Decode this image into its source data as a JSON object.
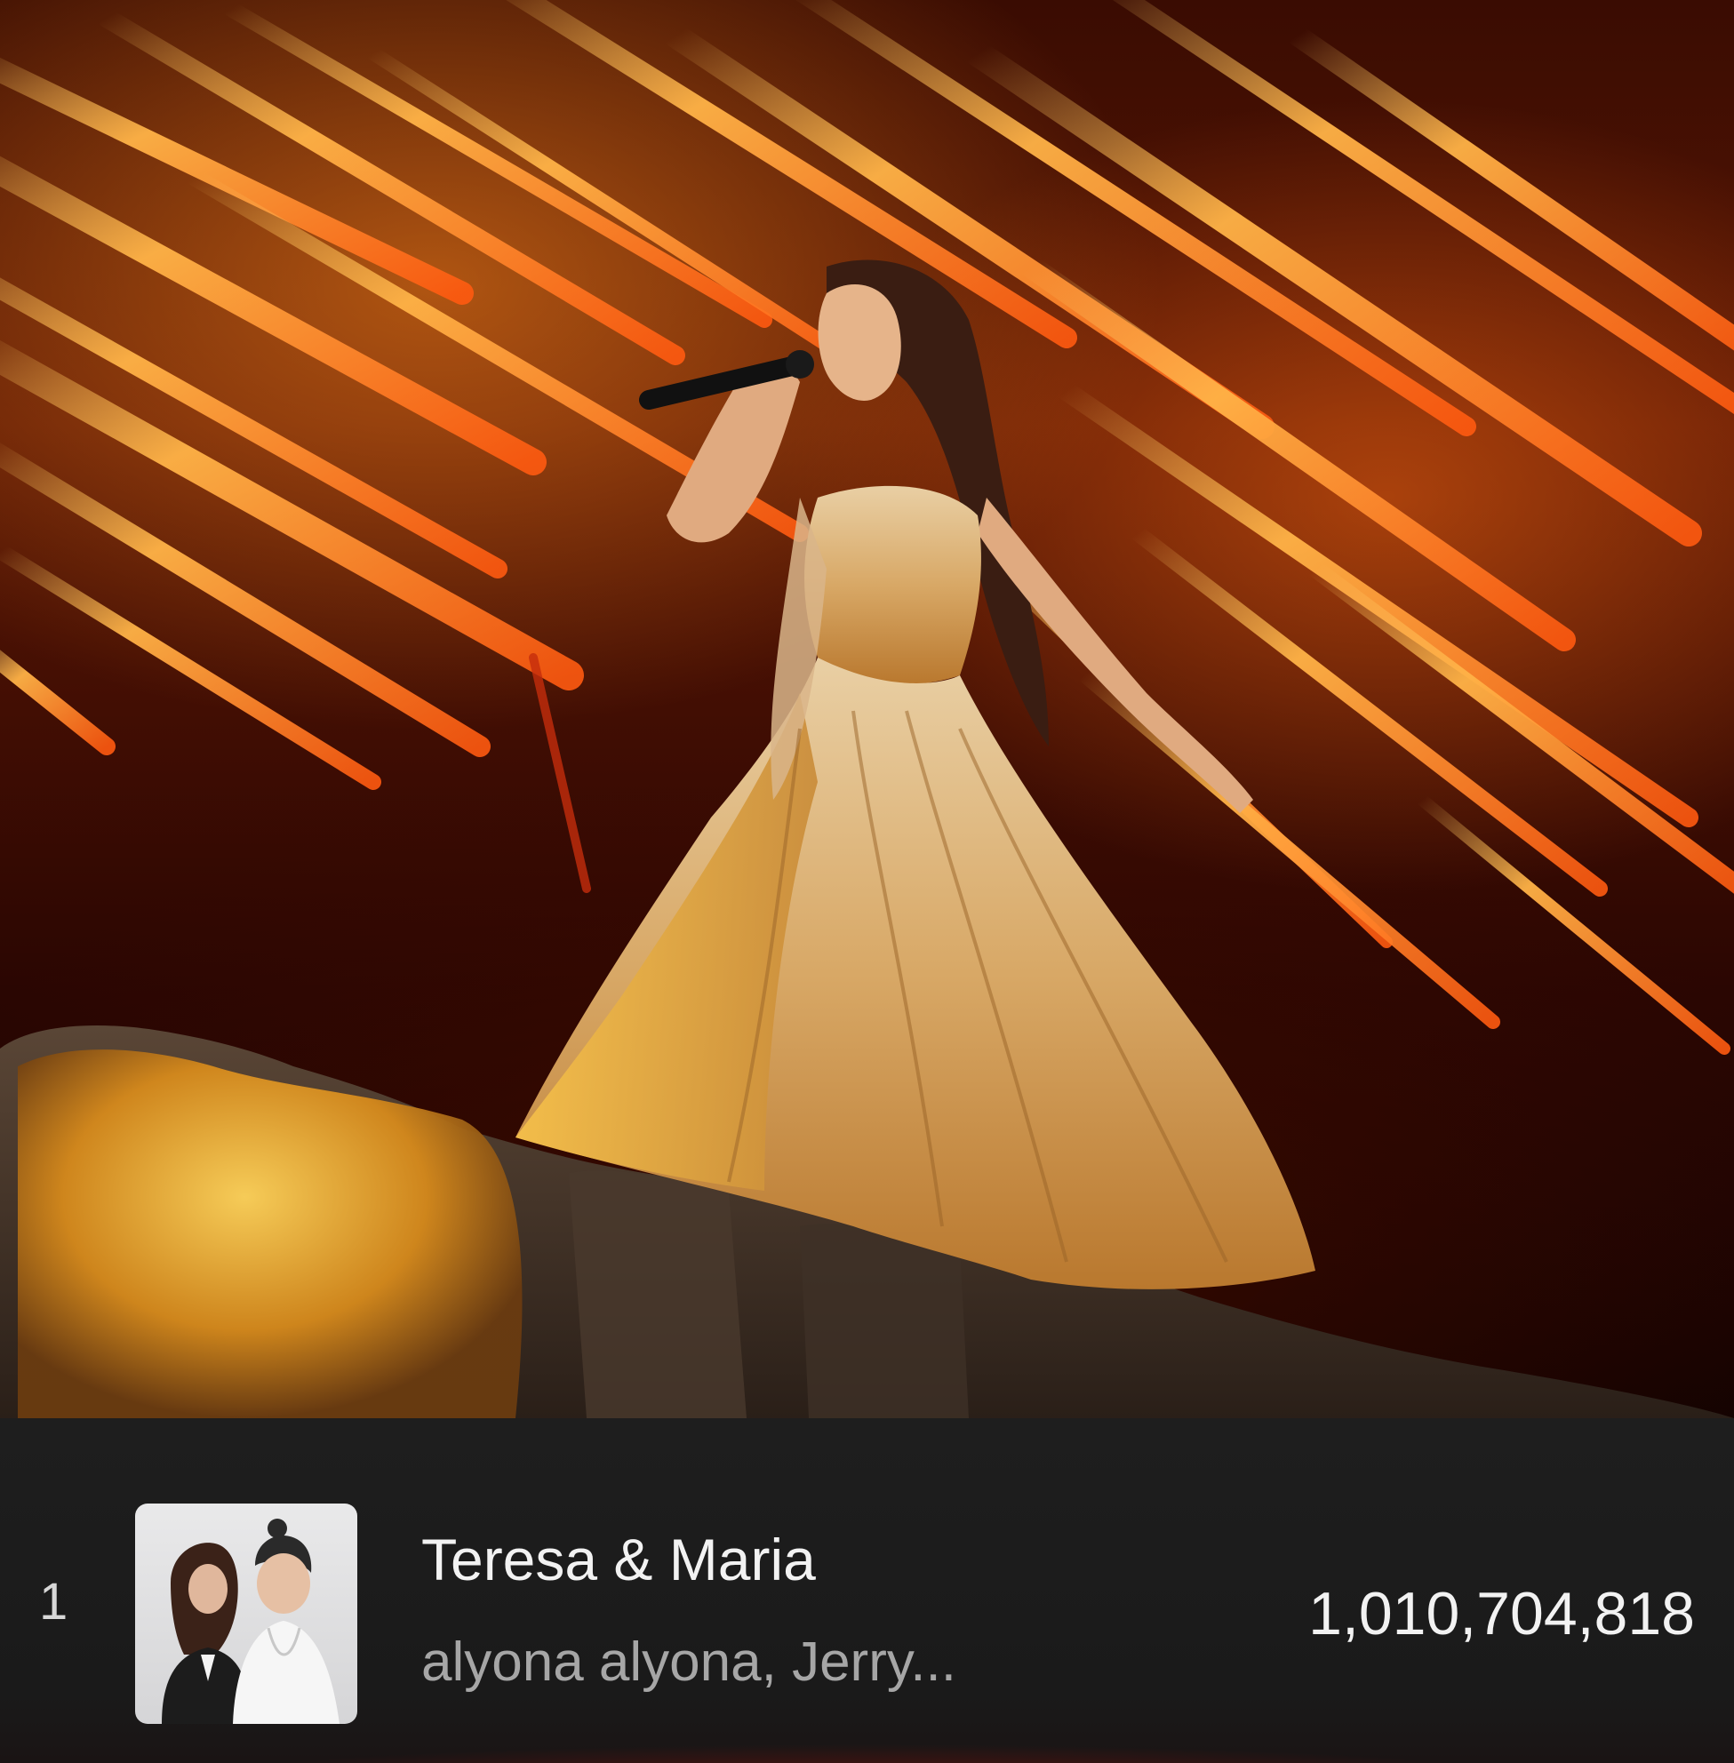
{
  "entry": {
    "rank": "1",
    "title": "Teresa & Maria",
    "artists": "alyona alyona, Jerry...",
    "streams": "1,010,704,818"
  },
  "colors": {
    "panel_background": "#1c1c1c",
    "title_text": "#f2f2f2",
    "secondary_text": "#a6a6a6",
    "fire_orange": "#ff7a18",
    "dress_gold": "#e7c48c"
  }
}
